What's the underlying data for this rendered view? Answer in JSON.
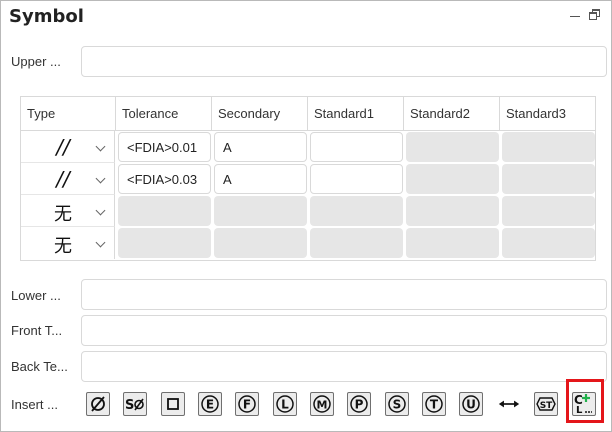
{
  "window": {
    "title": "Symbol"
  },
  "fields": {
    "upper_label": "Upper ...",
    "upper_value": "",
    "lower_label": "Lower ...",
    "lower_value": "",
    "front_label": "Front T...",
    "front_value": "",
    "back_label": "Back Te...",
    "back_value": "",
    "insert_label": "Insert ..."
  },
  "table": {
    "columns": [
      "Type",
      "Tolerance",
      "Secondary",
      "Standard1",
      "Standard2",
      "Standard3"
    ],
    "rows": [
      {
        "type": "//",
        "tolerance": "<FDIA>0.01",
        "secondary": "A",
        "standard1": ""
      },
      {
        "type": "//",
        "tolerance": "<FDIA>0.03",
        "secondary": "A",
        "standard1": ""
      },
      {
        "type": "无",
        "tolerance": "",
        "secondary": "",
        "standard1": ""
      },
      {
        "type": "无",
        "tolerance": "",
        "secondary": "",
        "standard1": ""
      }
    ]
  },
  "insert_symbols": [
    "diameter-icon",
    "spherical-diameter-icon",
    "square-icon",
    "circle-e-icon",
    "circle-f-icon",
    "circle-l-icon",
    "circle-m-icon",
    "circle-p-icon",
    "circle-s-icon",
    "circle-t-icon",
    "circle-u-icon",
    "between-arrow-icon",
    "statistical-st-icon",
    "custom-add-icon"
  ],
  "insert_text": {
    "square_s": "S",
    "st": "ST",
    "c": "C",
    "l": "L",
    "e": "E",
    "f": "F",
    "lc": "L",
    "m": "M",
    "p": "P",
    "s": "S",
    "t": "T",
    "u": "U"
  },
  "colors": {
    "highlight": "#e4161a",
    "add_green": "#22b14c"
  }
}
